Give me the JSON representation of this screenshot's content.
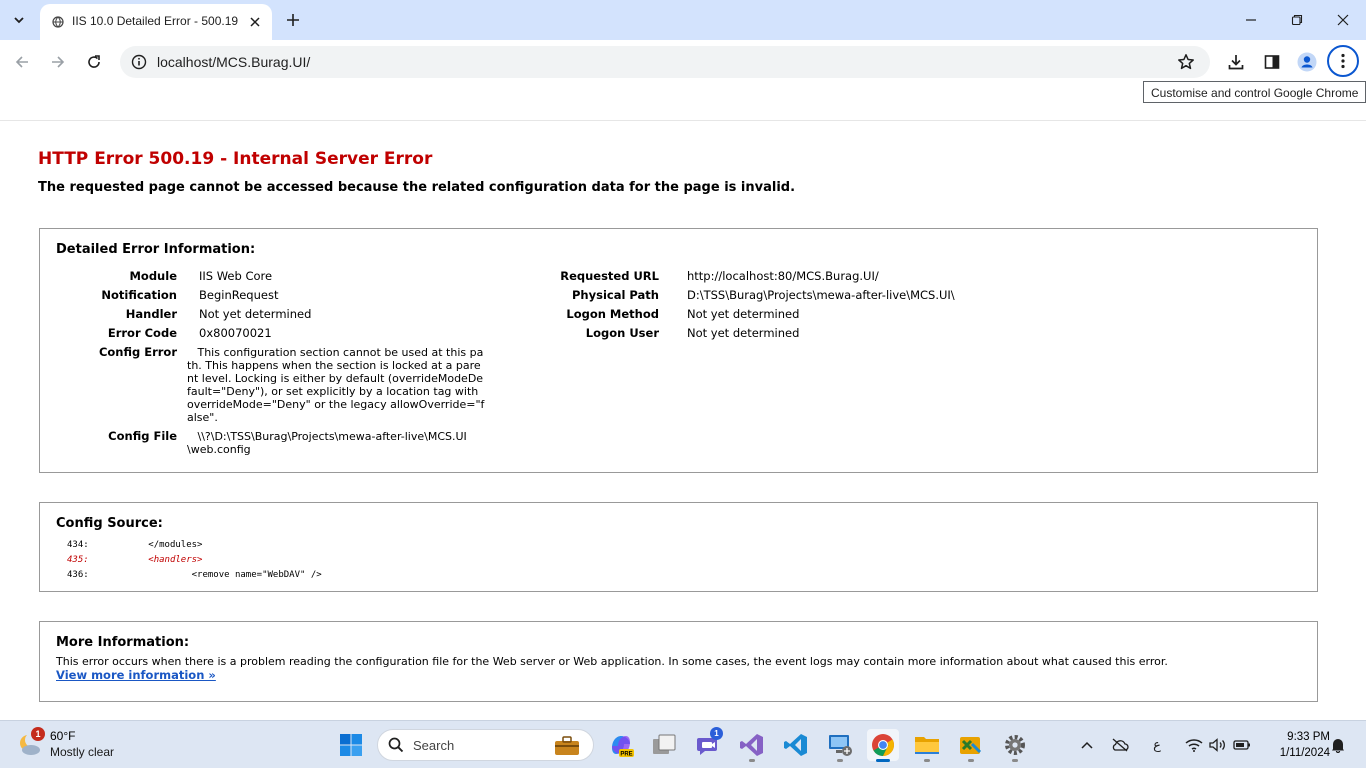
{
  "browser": {
    "tab_title": "IIS 10.0 Detailed Error - 500.19",
    "url": "localhost/MCS.Burag.UI/",
    "tooltip": "Customise and control Google Chrome"
  },
  "page": {
    "title": "HTTP Error 500.19 - Internal Server Error",
    "subtitle": "The requested page cannot be accessed because the related configuration data for the page is invalid.",
    "detailed": {
      "heading": "Detailed Error Information:",
      "left": [
        {
          "label": "Module",
          "value": "IIS Web Core"
        },
        {
          "label": "Notification",
          "value": "BeginRequest"
        },
        {
          "label": "Handler",
          "value": "Not yet determined"
        },
        {
          "label": "Error Code",
          "value": "0x80070021"
        }
      ],
      "config_error_label": "Config Error",
      "config_error_text": "   This configuration section cannot be used at this pa\nth. This happens when the section is locked at a pare\nnt level. Locking is either by default (overrideModeDe\nfault=\"Deny\"), or set explicitly by a location tag with\noverrideMode=\"Deny\" or the legacy allowOverride=\"f\nalse\".",
      "config_file_label": "Config File",
      "config_file_text": "   \\\\?\\D:\\TSS\\Burag\\Projects\\mewa-after-live\\MCS.UI\n\\web.config",
      "right": [
        {
          "label": "Requested URL",
          "value": "http://localhost:80/MCS.Burag.UI/"
        },
        {
          "label": "Physical Path",
          "value": "D:\\TSS\\Burag\\Projects\\mewa-after-live\\MCS.UI\\"
        },
        {
          "label": "Logon Method",
          "value": "Not yet determined"
        },
        {
          "label": "Logon User",
          "value": "Not yet determined"
        }
      ]
    },
    "config_source": {
      "heading": "Config Source:",
      "lines": [
        "434:           </modules>",
        "435:           <handlers>",
        "436:                   <remove name=\"WebDAV\" />"
      ]
    },
    "more_info": {
      "heading": "More Information:",
      "text": "This error occurs when there is a problem reading the configuration file for the Web server or Web application. In some cases, the event logs may contain more information about what caused this error.",
      "link": "View more information »"
    }
  },
  "taskbar": {
    "weather_temp": "60°F",
    "weather_desc": "Mostly clear",
    "weather_badge": "1",
    "search_label": "Search",
    "teams_badge": "1",
    "time": "9:33 PM",
    "date": "1/11/2024",
    "lang": "ع"
  }
}
